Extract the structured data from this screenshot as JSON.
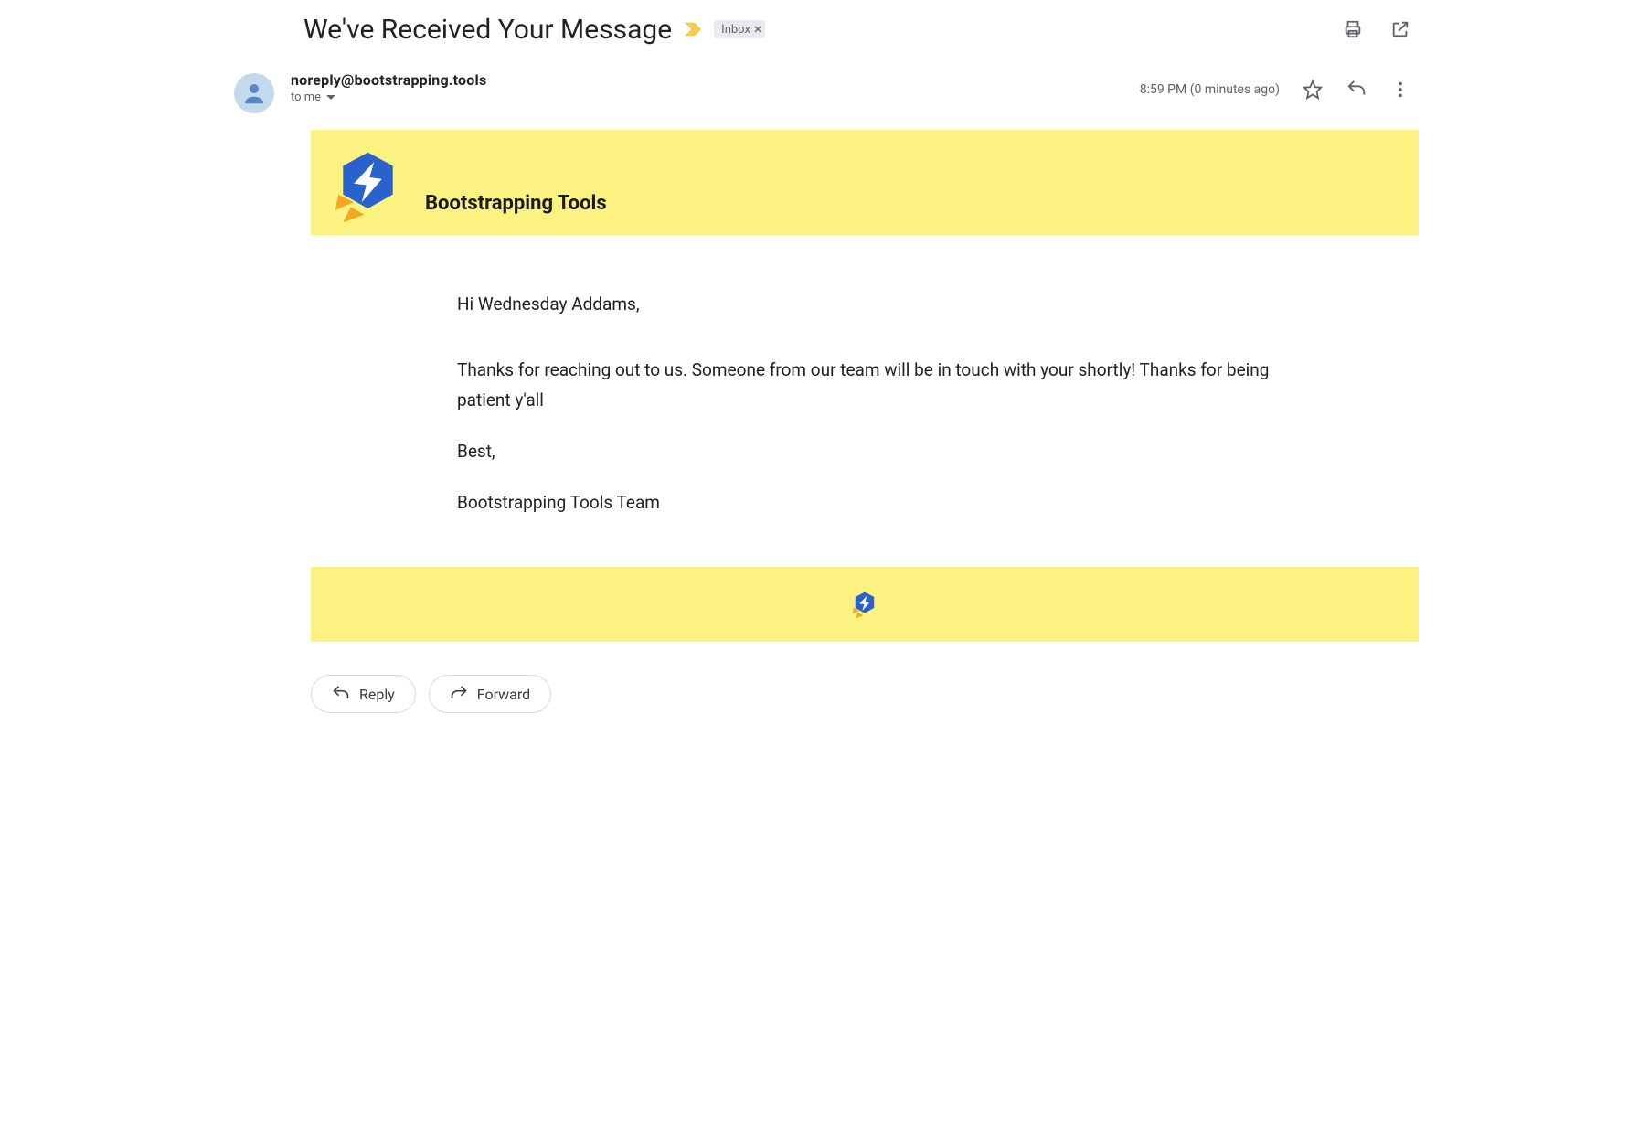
{
  "subject": "We've Received Your Message",
  "label": {
    "name": "Inbox"
  },
  "sender": {
    "email": "noreply@bootstrapping.tools",
    "recipient_display": "to me"
  },
  "timestamp": "8:59 PM (0 minutes ago)",
  "brand": {
    "title": "Bootstrapping Tools"
  },
  "body": {
    "greeting": "Hi Wednesday Addams,",
    "message": "Thanks for reaching out to us. Someone from our team will be in touch with your shortly! Thanks for being patient y'all",
    "salutation": "Best,",
    "signature": "Bootstrapping Tools Team"
  },
  "actions": {
    "reply": "Reply",
    "forward": "Forward"
  }
}
